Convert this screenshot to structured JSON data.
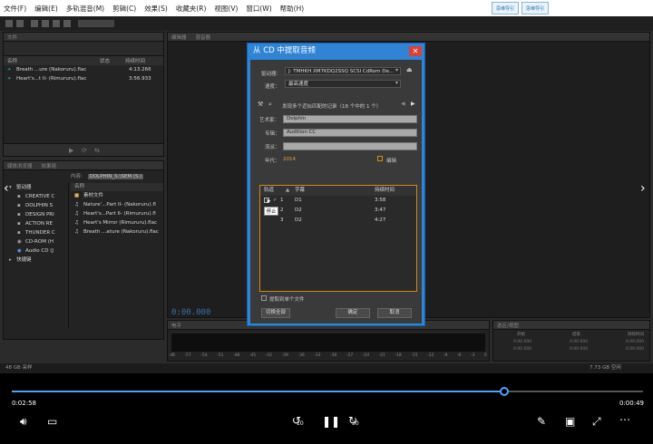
{
  "menu": [
    "文件(F)",
    "编辑(E)",
    "多轨混音(M)",
    "剪辑(C)",
    "效果(S)",
    "收藏夹(R)",
    "视图(V)",
    "窗口(W)",
    "帮助(H)"
  ],
  "logos": [
    "思维导引",
    "思维导引"
  ],
  "files_panel": {
    "tab": "文件",
    "columns": [
      "名称",
      "状态",
      "持续时间"
    ],
    "rows": [
      {
        "name": "Breath ...ure (Nakoruru).flac",
        "duration": "4:13.266"
      },
      {
        "name": "Heart's...t II- (Rimururu).flac",
        "duration": "3:56.933"
      }
    ]
  },
  "browser_panel": {
    "tabs": [
      "媒体浏览器",
      "效果组"
    ],
    "tree": [
      "驱动器",
      "CREATIVE C",
      "DOLPHIN S",
      "DESIGN PRI",
      "ACTION RE",
      "THUNDER C",
      "CD-ROM (H",
      "Audio CD (J",
      "快捷键"
    ],
    "path_label": "内容:",
    "path": "DOLPHIN_S:\\SEM (S:)",
    "list_header": "名称",
    "list": [
      "素材文件",
      "Nature'...Part II- (Nakoruru).fl",
      "Heart's...Part II- (Rimururu).fl",
      "Heart's Mirror (Rimururu).flac",
      "Breath ...ature (Nakoruru).flac"
    ]
  },
  "editor": {
    "tabs": [
      "编辑器",
      "混音器"
    ],
    "time": "0:00.000"
  },
  "level_meter": {
    "title": "电平",
    "scale": [
      "dB",
      "-57",
      "-54",
      "-51",
      "-48",
      "-45",
      "-42",
      "-39",
      "-36",
      "-33",
      "-30",
      "-27",
      "-24",
      "-21",
      "-18",
      "-15",
      "-12",
      "-9",
      "-6",
      "-3",
      "0"
    ]
  },
  "selection_panel": {
    "title": "选区/视图",
    "headers": [
      "开始",
      "结束",
      "持续时间"
    ],
    "rows": [
      [
        "0:00.000",
        "0:00.000",
        "0:00.000"
      ],
      [
        "0:00.000",
        "0:00.000",
        "0:00.000"
      ]
    ]
  },
  "status": {
    "left": "48 GB 采样",
    "right": "7.73 GB 空闲"
  },
  "dialog": {
    "title": "从 CD 中提取音频",
    "close": "✕",
    "drive_label": "驱动器：",
    "drive_value": "J: TMHKH XM7KDQ2SSQ SCSI CdRom De...",
    "speed_label": "速度：",
    "speed_value": "最高速度",
    "match_text": "发现多个近似匹配的记录（18 个中的 1 个）",
    "artist_label": "艺术家：",
    "artist": "Dolphin",
    "album_label": "专辑：",
    "album": "Audition CC",
    "genre_label": "流派：",
    "genre": "",
    "year_label": "年代：",
    "year": "2014",
    "edit_label": "编辑",
    "track_headers": [
      "轨道",
      "字幕",
      "持续时间"
    ],
    "tracks": [
      {
        "num": "1",
        "title": "D1",
        "duration": "3:58"
      },
      {
        "num": "2",
        "title": "D2",
        "duration": "3:47"
      },
      {
        "num": "3",
        "title": "D2",
        "duration": "4:27"
      }
    ],
    "tooltip": "停止",
    "extract_single_label": "提取到单个文件",
    "toggle_all": "切换全部",
    "ok": "确定",
    "cancel": "取消"
  },
  "player": {
    "elapsed": "0:02:58",
    "remaining": "0:00:49",
    "progress": 0.78,
    "skip_back": "10",
    "skip_forward": "30"
  },
  "colors": {
    "accent": "#2f84d6",
    "orange": "#d08a1a",
    "close": "#d9413a",
    "progress": "#4aa3ff"
  }
}
